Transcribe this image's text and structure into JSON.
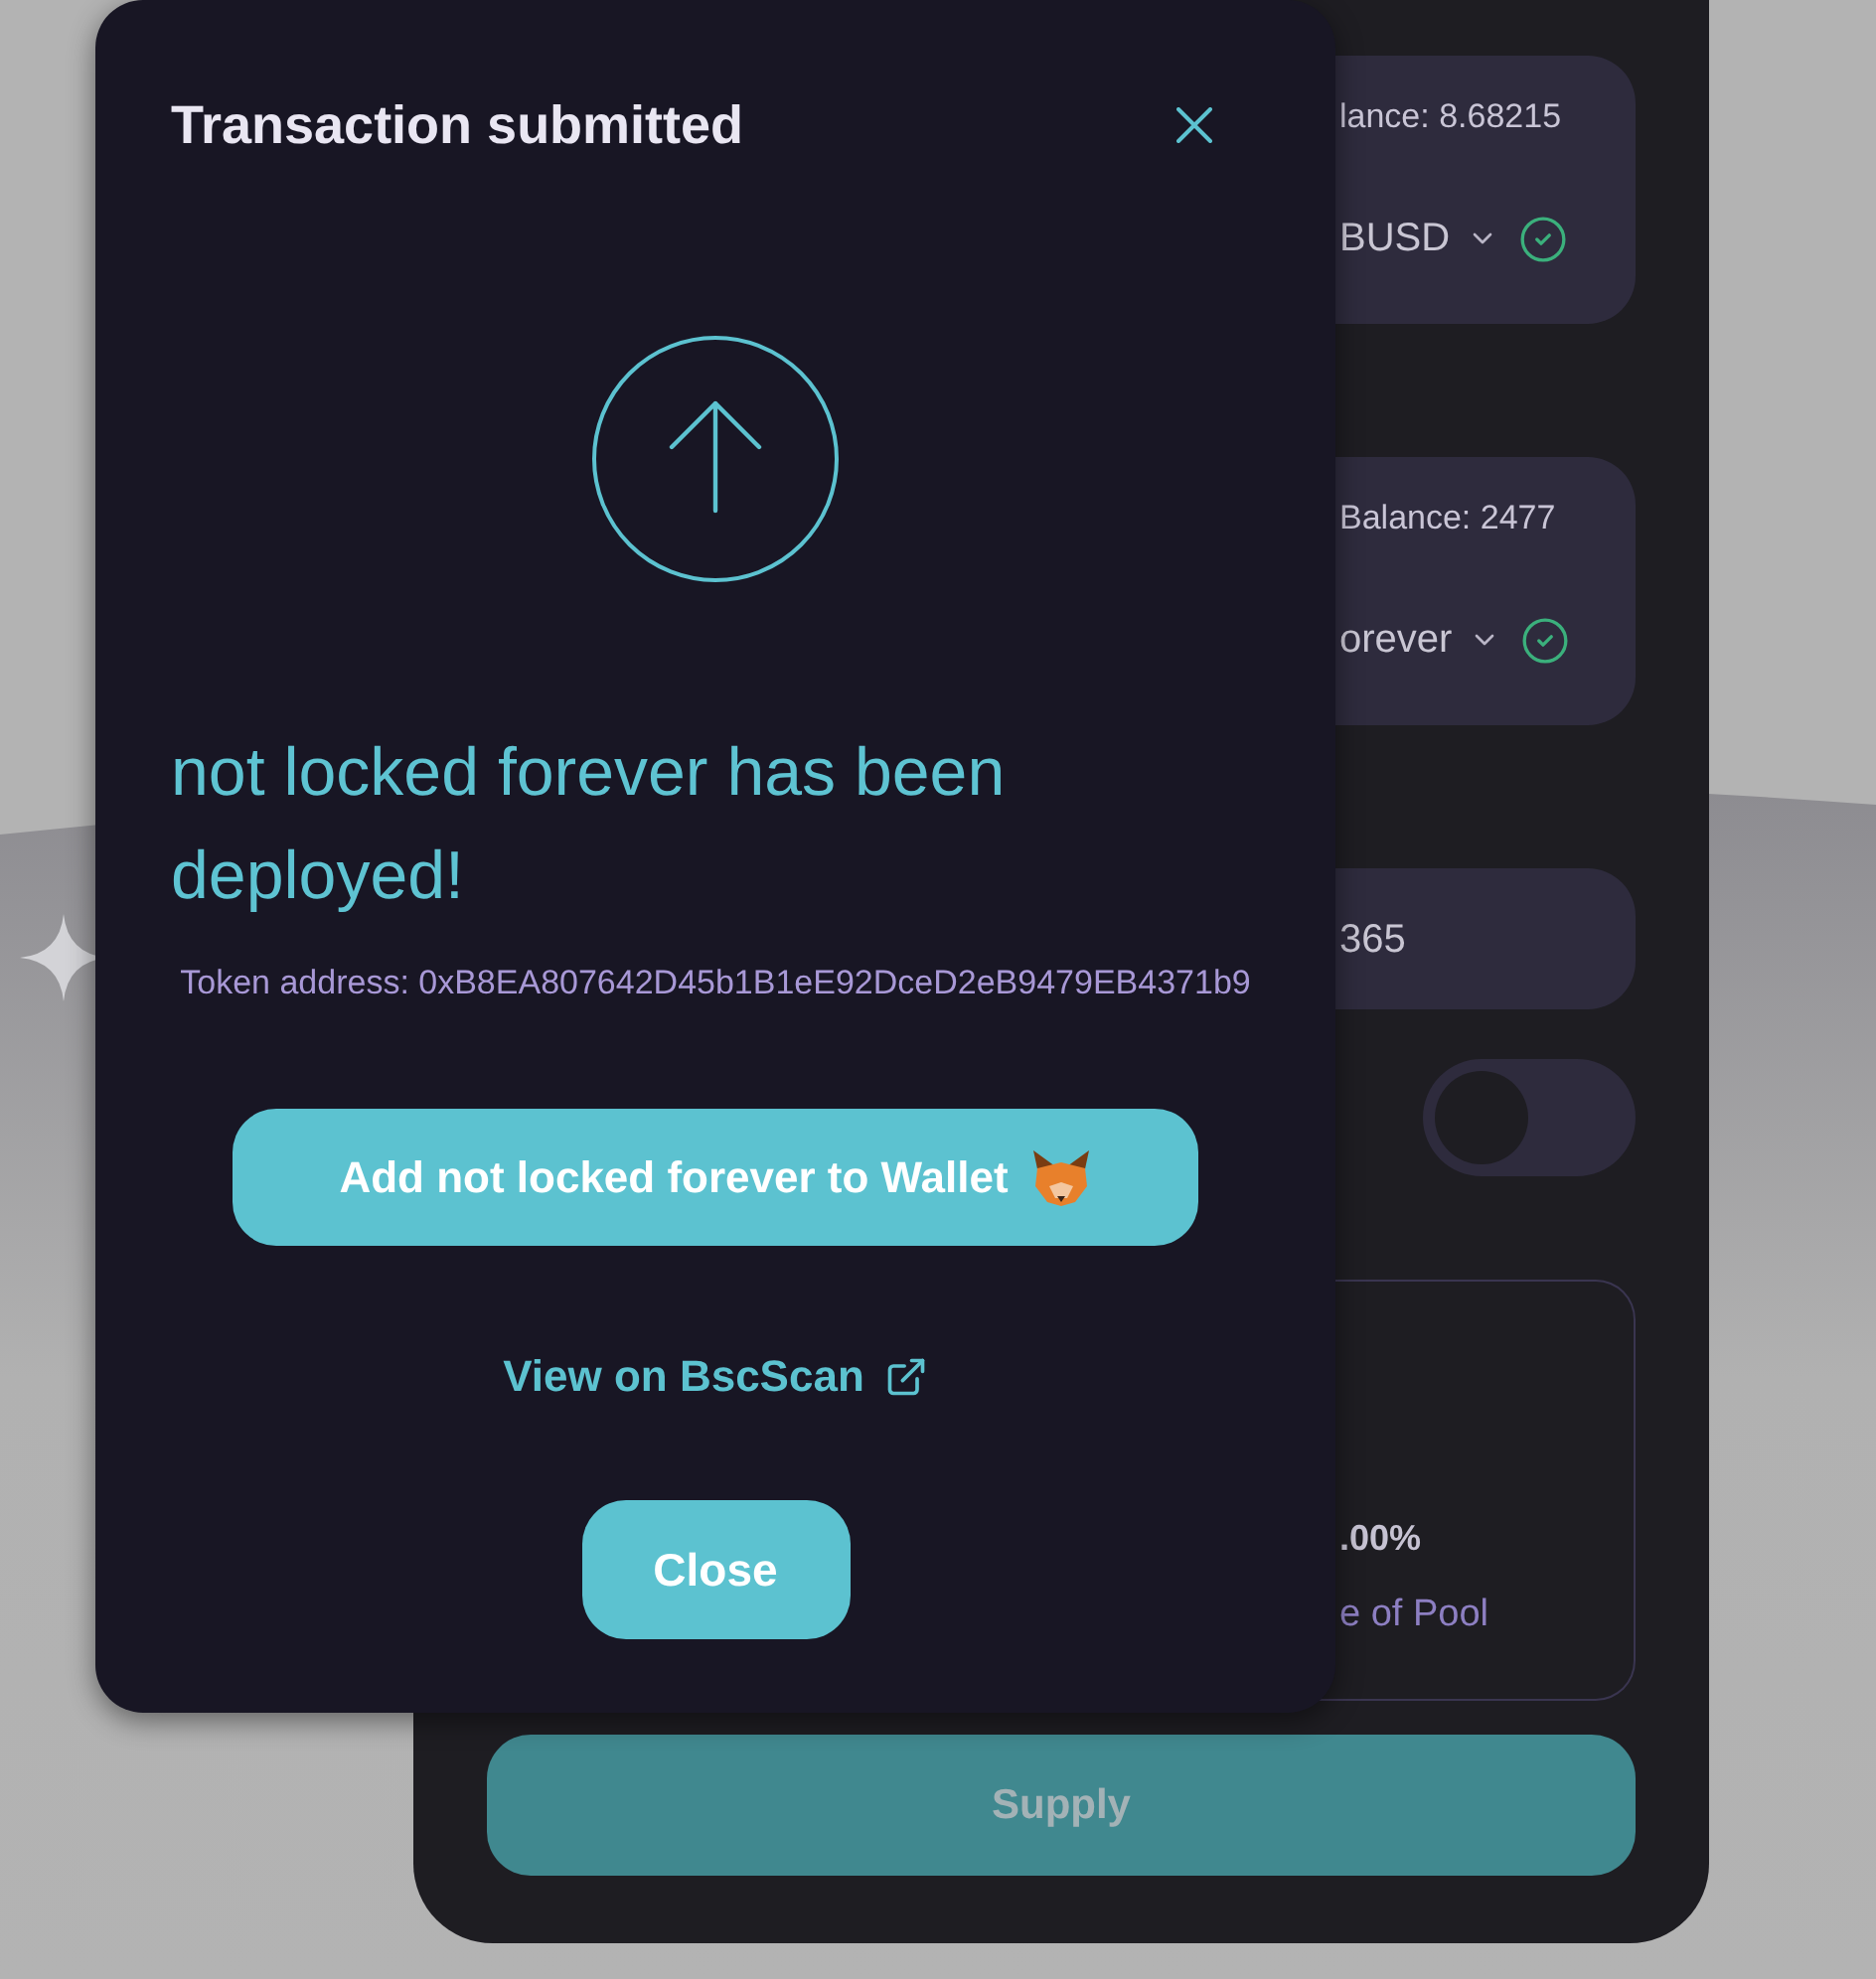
{
  "background_panel": {
    "cards": [
      {
        "kind": "token",
        "balance": "lance: 8.68215",
        "token": "BUSD",
        "verified": true
      },
      {
        "kind": "token",
        "balance": "Balance: 2477",
        "token": "orever",
        "verified": true
      },
      {
        "kind": "field",
        "value": "365"
      }
    ],
    "toggle": {
      "on": false
    },
    "pool_info": {
      "value": ".00%",
      "label": "e of Pool"
    },
    "supply_button": {
      "label": "Supply",
      "disabled": true
    }
  },
  "modal": {
    "title": "Transaction submitted",
    "message": "not locked forever has been deployed!",
    "token_address": "Token address: 0xB8EA807642D45b1B1eE92DceD2eB9479EB4371b9",
    "add_button": "Add not locked forever to Wallet",
    "explorer_link": "View on BscScan",
    "close_button": "Close"
  }
}
